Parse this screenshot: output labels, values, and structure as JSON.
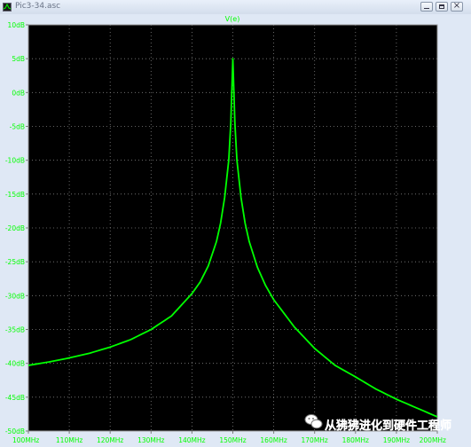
{
  "window": {
    "title": "Pic3-34.asc",
    "minimize_icon": "minimize-icon",
    "maximize_icon": "maximize-icon",
    "close_icon": "close-icon"
  },
  "watermark": {
    "text": "从狒狒进化到硬件工程师",
    "icon": "wechat-icon"
  },
  "colors": {
    "plot_background": "#000000",
    "trace": "#00ff00",
    "grid": "#808080",
    "tick_label": "#00ff00",
    "trace_label": "#00ff00"
  },
  "chart_data": {
    "type": "line",
    "title": "",
    "xlabel": "",
    "ylabel": "",
    "xlim": [
      100,
      200
    ],
    "ylim": [
      -50,
      10
    ],
    "grid": true,
    "series": [
      {
        "name": "V(e)",
        "x_unit": "MHz",
        "y_unit": "dB",
        "x": [
          100,
          105,
          110,
          115,
          120,
          125,
          130,
          135,
          140,
          142,
          144,
          146,
          147,
          148,
          149,
          149.5,
          150,
          150.5,
          151,
          152,
          153,
          154,
          156,
          158,
          160,
          165,
          170,
          175,
          180,
          185,
          190,
          195,
          200
        ],
        "y": [
          -40.3,
          -39.8,
          -39.2,
          -38.5,
          -37.6,
          -36.5,
          -35.0,
          -33.0,
          -29.7,
          -28.0,
          -25.6,
          -22.0,
          -19.3,
          -15.5,
          -10.0,
          -4.5,
          5.0,
          -4.5,
          -10.0,
          -15.5,
          -19.3,
          -22.0,
          -25.8,
          -28.5,
          -30.6,
          -34.6,
          -37.8,
          -40.3,
          -42.0,
          -43.8,
          -45.3,
          -46.6,
          -47.9
        ]
      }
    ],
    "yticks": [
      "10dB",
      "5dB",
      "0dB",
      "-5dB",
      "-10dB",
      "-15dB",
      "-20dB",
      "-25dB",
      "-30dB",
      "-35dB",
      "-40dB",
      "-45dB",
      "-50dB"
    ],
    "xticks": [
      "100MHz",
      "110MHz",
      "120MHz",
      "130MHz",
      "140MHz",
      "150MHz",
      "160MHz",
      "170MHz",
      "180MHz",
      "190MHz",
      "200MHz"
    ]
  }
}
